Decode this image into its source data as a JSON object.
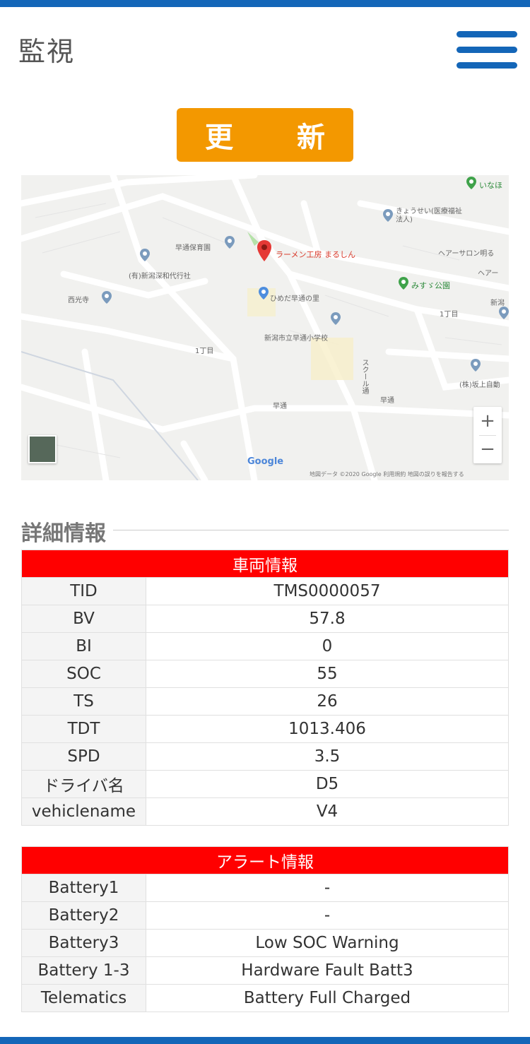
{
  "header": {
    "title": "監視",
    "menu_icon": "hamburger-menu-icon"
  },
  "actions": {
    "refresh_label": "更 新"
  },
  "map": {
    "labels": {
      "ramen": "ラーメン工房 まるしん",
      "nursery": "早通保育園",
      "company": "(有)新潟深和代行社",
      "temple": "西光寺",
      "park_street": "ひめだ早通の里",
      "school": "新潟市立早通小学校",
      "district_1": "1丁目",
      "district_2": "1丁目",
      "sawadori": "早通",
      "station": "早通",
      "nursery_care": "きょうせい(医療福祉法人)",
      "hair_salon": "ヘアーサロン明る",
      "hair2": "ヘアー",
      "misuzu_park": "みすゞ公園",
      "top_right": "いなほ",
      "corner": "(株)坂上自動",
      "new_road": "新潟",
      "vertical_road": "スクール通"
    },
    "zoom_in": "+",
    "zoom_out": "−",
    "google_logo": "Google",
    "attribution": "地図データ ©2020 Google  利用規約  地図の誤りを報告する"
  },
  "details": {
    "heading": "詳細情報"
  },
  "vehicle": {
    "title": "車両情報",
    "rows": [
      {
        "key": "TID",
        "value": "TMS0000057"
      },
      {
        "key": "BV",
        "value": "57.8"
      },
      {
        "key": "BI",
        "value": "0"
      },
      {
        "key": "SOC",
        "value": "55"
      },
      {
        "key": "TS",
        "value": "26"
      },
      {
        "key": "TDT",
        "value": "1013.406"
      },
      {
        "key": "SPD",
        "value": "3.5"
      },
      {
        "key": "ドライバ名",
        "value": "D5"
      },
      {
        "key": "vehiclename",
        "value": "V4"
      }
    ]
  },
  "alert": {
    "title": "アラート情報",
    "rows": [
      {
        "key": "Battery1",
        "value": "-"
      },
      {
        "key": "Battery2",
        "value": "-"
      },
      {
        "key": "Battery3",
        "value": "Low SOC Warning"
      },
      {
        "key": "Battery 1-3",
        "value": "Hardware Fault Batt3"
      },
      {
        "key": "Telematics",
        "value": "Battery Full Charged"
      }
    ]
  },
  "colors": {
    "brand_blue": "#1466b8",
    "refresh_orange": "#f39800",
    "table_header_red": "#ff0000"
  }
}
